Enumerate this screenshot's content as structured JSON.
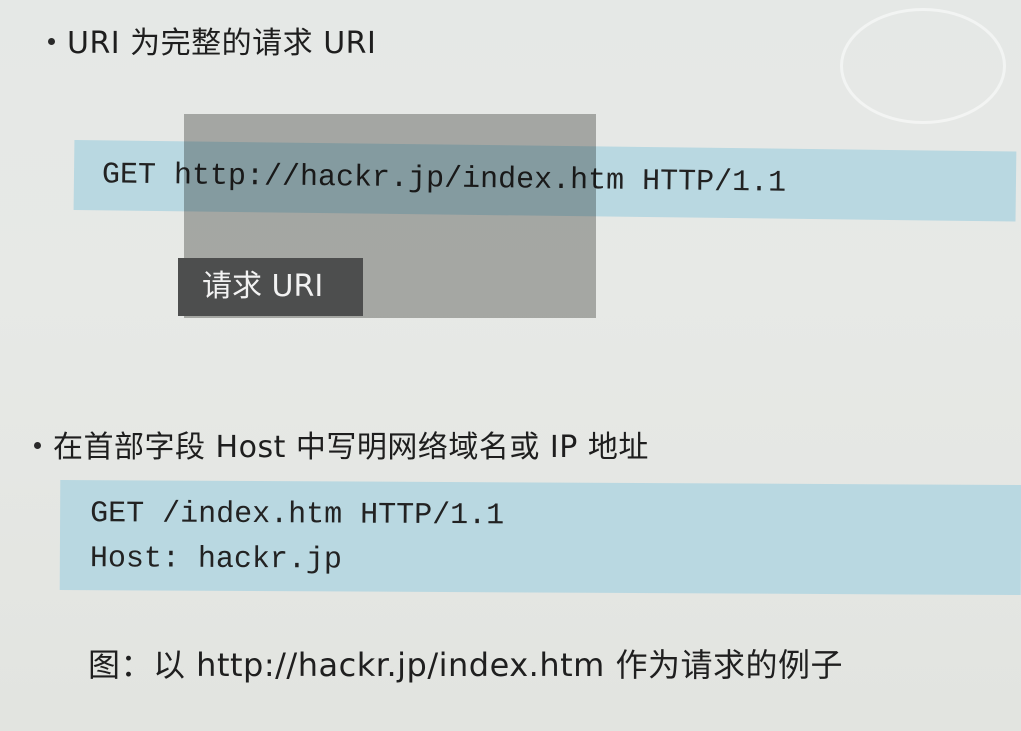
{
  "sections": [
    {
      "heading": "URI 为完整的请求 URI",
      "request_line": "GET http://hackr.jp/index.htm HTTP/1.1",
      "label": "请求 URI"
    },
    {
      "heading": "在首部字段 Host 中写明网络域名或 IP 地址",
      "lines": [
        "GET /index.htm HTTP/1.1",
        "Host: hackr.jp"
      ]
    }
  ],
  "caption": "图：以 http://hackr.jp/index.htm 作为请求的例子"
}
